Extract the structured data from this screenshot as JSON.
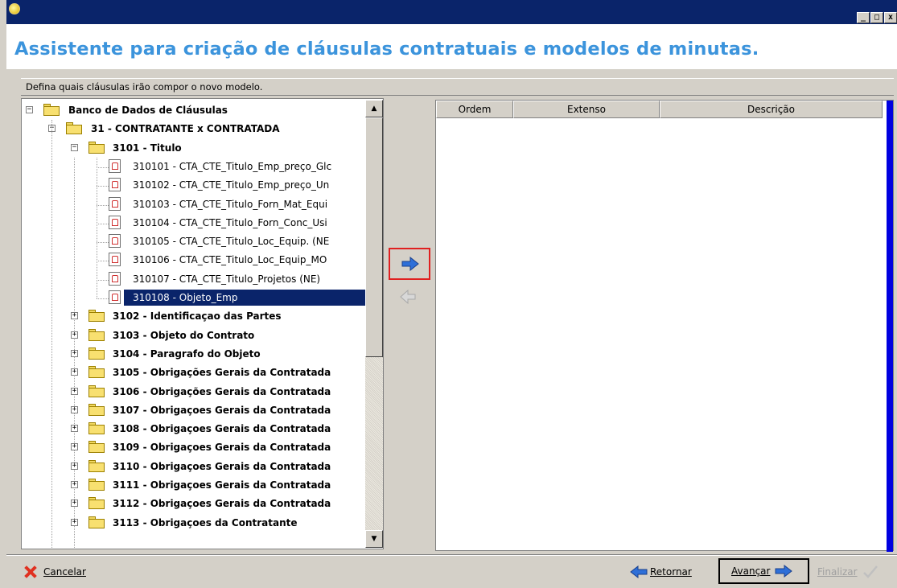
{
  "window": {
    "minimize": "_",
    "maximize": "□",
    "close": "x"
  },
  "header": {
    "title": "Assistente para criação de cláusulas contratuais e modelos de minutas."
  },
  "instruction": "Defina quais cláusulas irão compor o novo modelo.",
  "tree": {
    "root": "Banco de Dados de Cláusulas",
    "group": "31 - CONTRATANTE x CONTRATADA",
    "subgroup": "3101 - Titulo",
    "leaves": [
      "310101 - CTA_CTE_Titulo_Emp_preço_Glc",
      "310102 - CTA_CTE_Titulo_Emp_preço_Un",
      "310103 - CTA_CTE_Titulo_Forn_Mat_Equi",
      "310104 - CTA_CTE_Titulo_Forn_Conc_Usi",
      "310105 - CTA_CTE_Titulo_Loc_Equip. (NE",
      "310106 - CTA_CTE_Titulo_Loc_Equip_MO",
      "310107 - CTA_CTE_Titulo_Projetos (NE)",
      "310108 - Objeto_Emp"
    ],
    "folders": [
      "3102 - Identificaçao das Partes",
      "3103 - Objeto do Contrato",
      "3104 - Paragrafo do Objeto",
      "3105 - Obrigações Gerais da Contratada",
      "3106 - Obrigações Gerais da Contratada",
      "3107 - Obrigaçoes Gerais da Contratada",
      "3108 - Obrigaçoes Gerais da Contratada",
      "3109 - Obrigaçoes Gerais da Contratada",
      "3110 - Obrigaçoes Gerais da Contratada",
      "3111 - Obrigaçoes Gerais da Contratada",
      "3112 - Obrigaçoes Gerais da Contratada",
      "3113 - Obrigaçoes da Contratante"
    ],
    "selected_index": 7
  },
  "list": {
    "columns": [
      "Ordem",
      "Extenso",
      "Descrição"
    ]
  },
  "footer": {
    "cancel": "Cancelar",
    "back": "Retornar",
    "next": "Avançar",
    "finish": "Finalizar"
  },
  "colors": {
    "title_text": "#3c94dc",
    "titlebar": "#0a246a",
    "selection": "#0a246a",
    "highlight_border": "#e02020",
    "arrow_blue": "#2e6fd8"
  }
}
